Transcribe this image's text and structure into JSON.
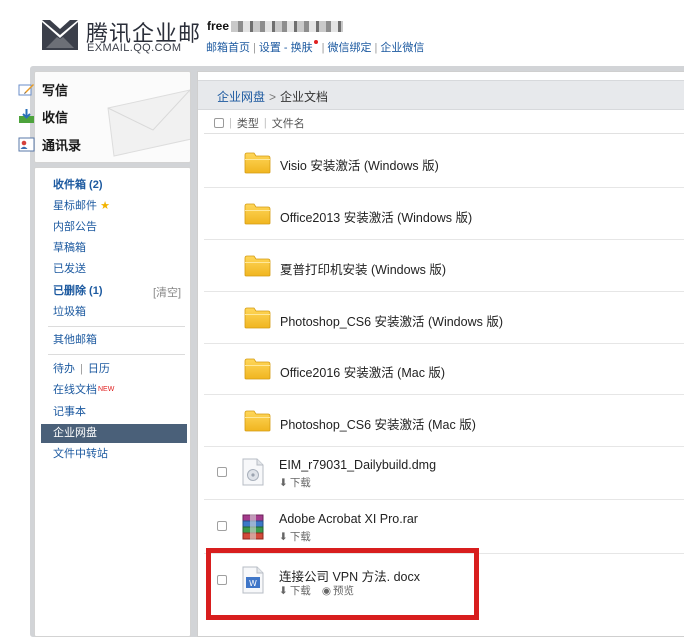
{
  "header": {
    "logo_title": "腾讯企业邮",
    "logo_subtitle": "EXMAIL.QQ.COM",
    "user_prefix": "free",
    "links": [
      "邮箱首页",
      "设置 - 换肤",
      "微信绑定",
      "企业微信"
    ],
    "separator": "|"
  },
  "sidebar": {
    "actions": [
      {
        "label": "写信",
        "icon": "compose-icon"
      },
      {
        "label": "收信",
        "icon": "inbox-download-icon"
      },
      {
        "label": "通讯录",
        "icon": "contacts-icon"
      }
    ],
    "folders": {
      "inbox": "收件箱 (2)",
      "starred": "星标邮件",
      "notice": "内部公告",
      "drafts": "草稿箱",
      "sent": "已发送",
      "deleted": "已删除 (1)",
      "deleted_clear": "[清空]",
      "spam": "垃圾箱"
    },
    "other_mailbox": "其他邮箱",
    "tools": {
      "todo": "待办",
      "calendar": "日历",
      "online_docs": "在线文档",
      "new_tag": "NEW",
      "notes": "记事本",
      "netdisk": "企业网盘",
      "transfer": "文件中转站"
    },
    "active_item": "企业网盘"
  },
  "main": {
    "breadcrumb": {
      "root": "企业网盘",
      "separator": ">",
      "current": "企业文档"
    },
    "columns": {
      "type": "类型",
      "filename": "文件名"
    },
    "folders": [
      "Visio 安装激活 (Windows 版)",
      "Office2013 安装激活 (Windows 版)",
      "夏普打印机安装 (Windows 版)",
      "Photoshop_CS6 安装激活 (Windows 版)",
      "Office2016 安装激活 (Mac 版)",
      "Photoshop_CS6 安装激活 (Mac 版)"
    ],
    "files": [
      {
        "name": "EIM_r79031_Dailybuild.dmg",
        "download": "下载"
      },
      {
        "name": "Adobe Acrobat XI Pro.rar",
        "download": "下载"
      },
      {
        "name": "连接公司 VPN 方法. docx",
        "download": "下载",
        "preview": "预览"
      }
    ]
  },
  "colors": {
    "accent_link": "#1d5aa0",
    "active_nav": "#4a6079",
    "highlight": "#d81e1e",
    "folder": "#f5c028"
  }
}
